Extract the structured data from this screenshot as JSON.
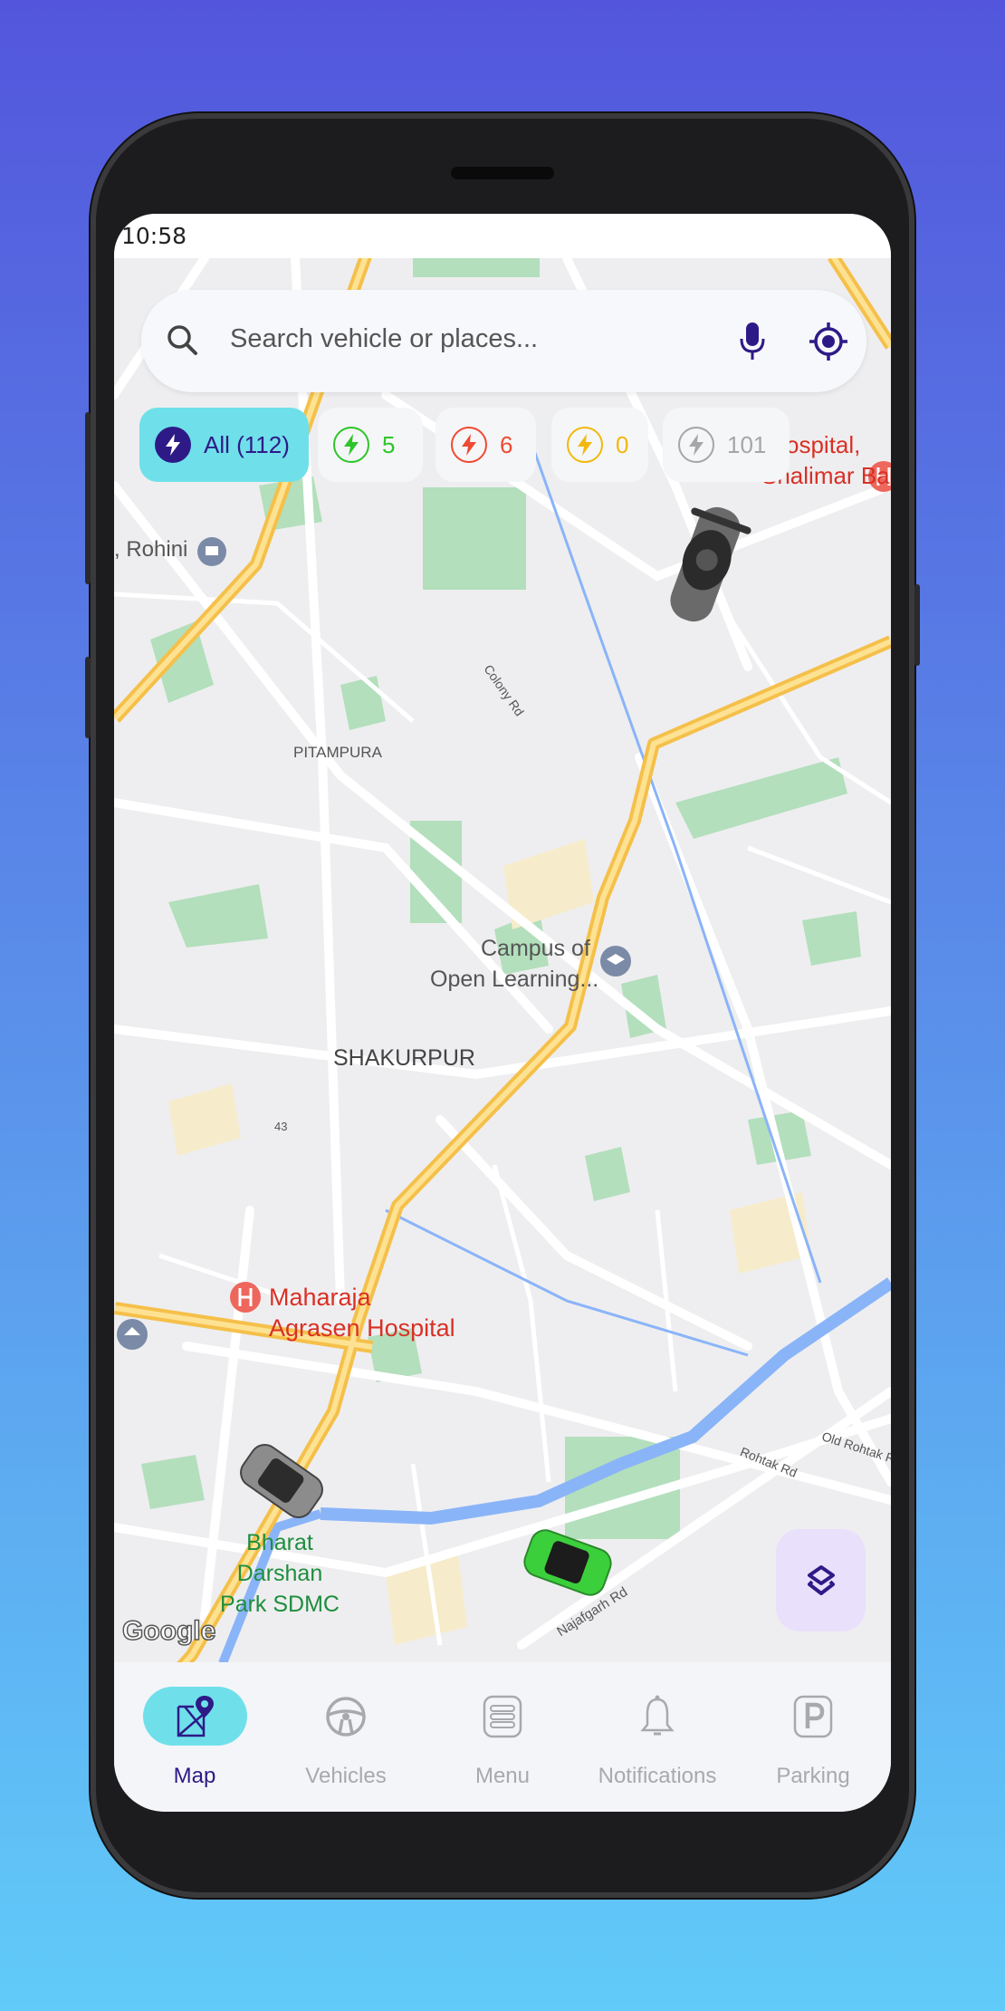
{
  "status_bar": {
    "time": "10:58"
  },
  "search": {
    "placeholder": "Search vehicle or places...",
    "icons": [
      "search-icon",
      "microphone-icon",
      "my-location-icon"
    ]
  },
  "filters": [
    {
      "label": "All (112)",
      "color": "#2e1a87",
      "bg": "#6fe0ea",
      "icon": "lightning-icon",
      "selected": true
    },
    {
      "label": "5",
      "color": "#2ec52a",
      "icon": "lightning-icon"
    },
    {
      "label": "6",
      "color": "#ef4a32",
      "icon": "lightning-icon"
    },
    {
      "label": "0",
      "color": "#f3b80c",
      "icon": "lightning-icon"
    },
    {
      "label": "101",
      "color": "#a6a6a6",
      "icon": "lightning-icon"
    }
  ],
  "map_labels": {
    "rohini": ", Rohini",
    "hospital_top_1": "ospital,",
    "hospital_top_2": "Shalimar Bagh",
    "colony_rd": "Colony Rd",
    "pitampura": "PITAMPURA",
    "campus_1": "Campus of",
    "campus_2": "Open Learning...",
    "shakurpur": "SHAKURPUR",
    "road_43": "43",
    "maharaja_1": "Maharaja",
    "maharaja_2": "Agrasen Hospital",
    "rohtak_rd": "Rohtak Rd",
    "old_rohtak_rd": "Old Rohtak Rd",
    "bharat_1": "Bharat",
    "bharat_2": "Darshan",
    "bharat_3": "Park SDMC",
    "najafgarh_rd": "Najafgarh Rd",
    "google": "Google"
  },
  "vehicles": [
    {
      "type": "motorbike",
      "color": "#555555"
    },
    {
      "type": "car",
      "color": "#8c8c8c"
    },
    {
      "type": "car",
      "color": "#3ccf3c"
    }
  ],
  "layers_button": {
    "icon": "layers-icon"
  },
  "bottom_nav": [
    {
      "label": "Map",
      "icon": "map-pin-icon",
      "active": true
    },
    {
      "label": "Vehicles",
      "icon": "steering-wheel-icon"
    },
    {
      "label": "Menu",
      "icon": "menu-icon"
    },
    {
      "label": "Notifications",
      "icon": "bell-icon"
    },
    {
      "label": "Parking",
      "icon": "parking-icon"
    }
  ],
  "colors": {
    "accent": "#2e1a87",
    "active_pill": "#6fe0ea",
    "layers_bg": "#e9e0fc"
  }
}
